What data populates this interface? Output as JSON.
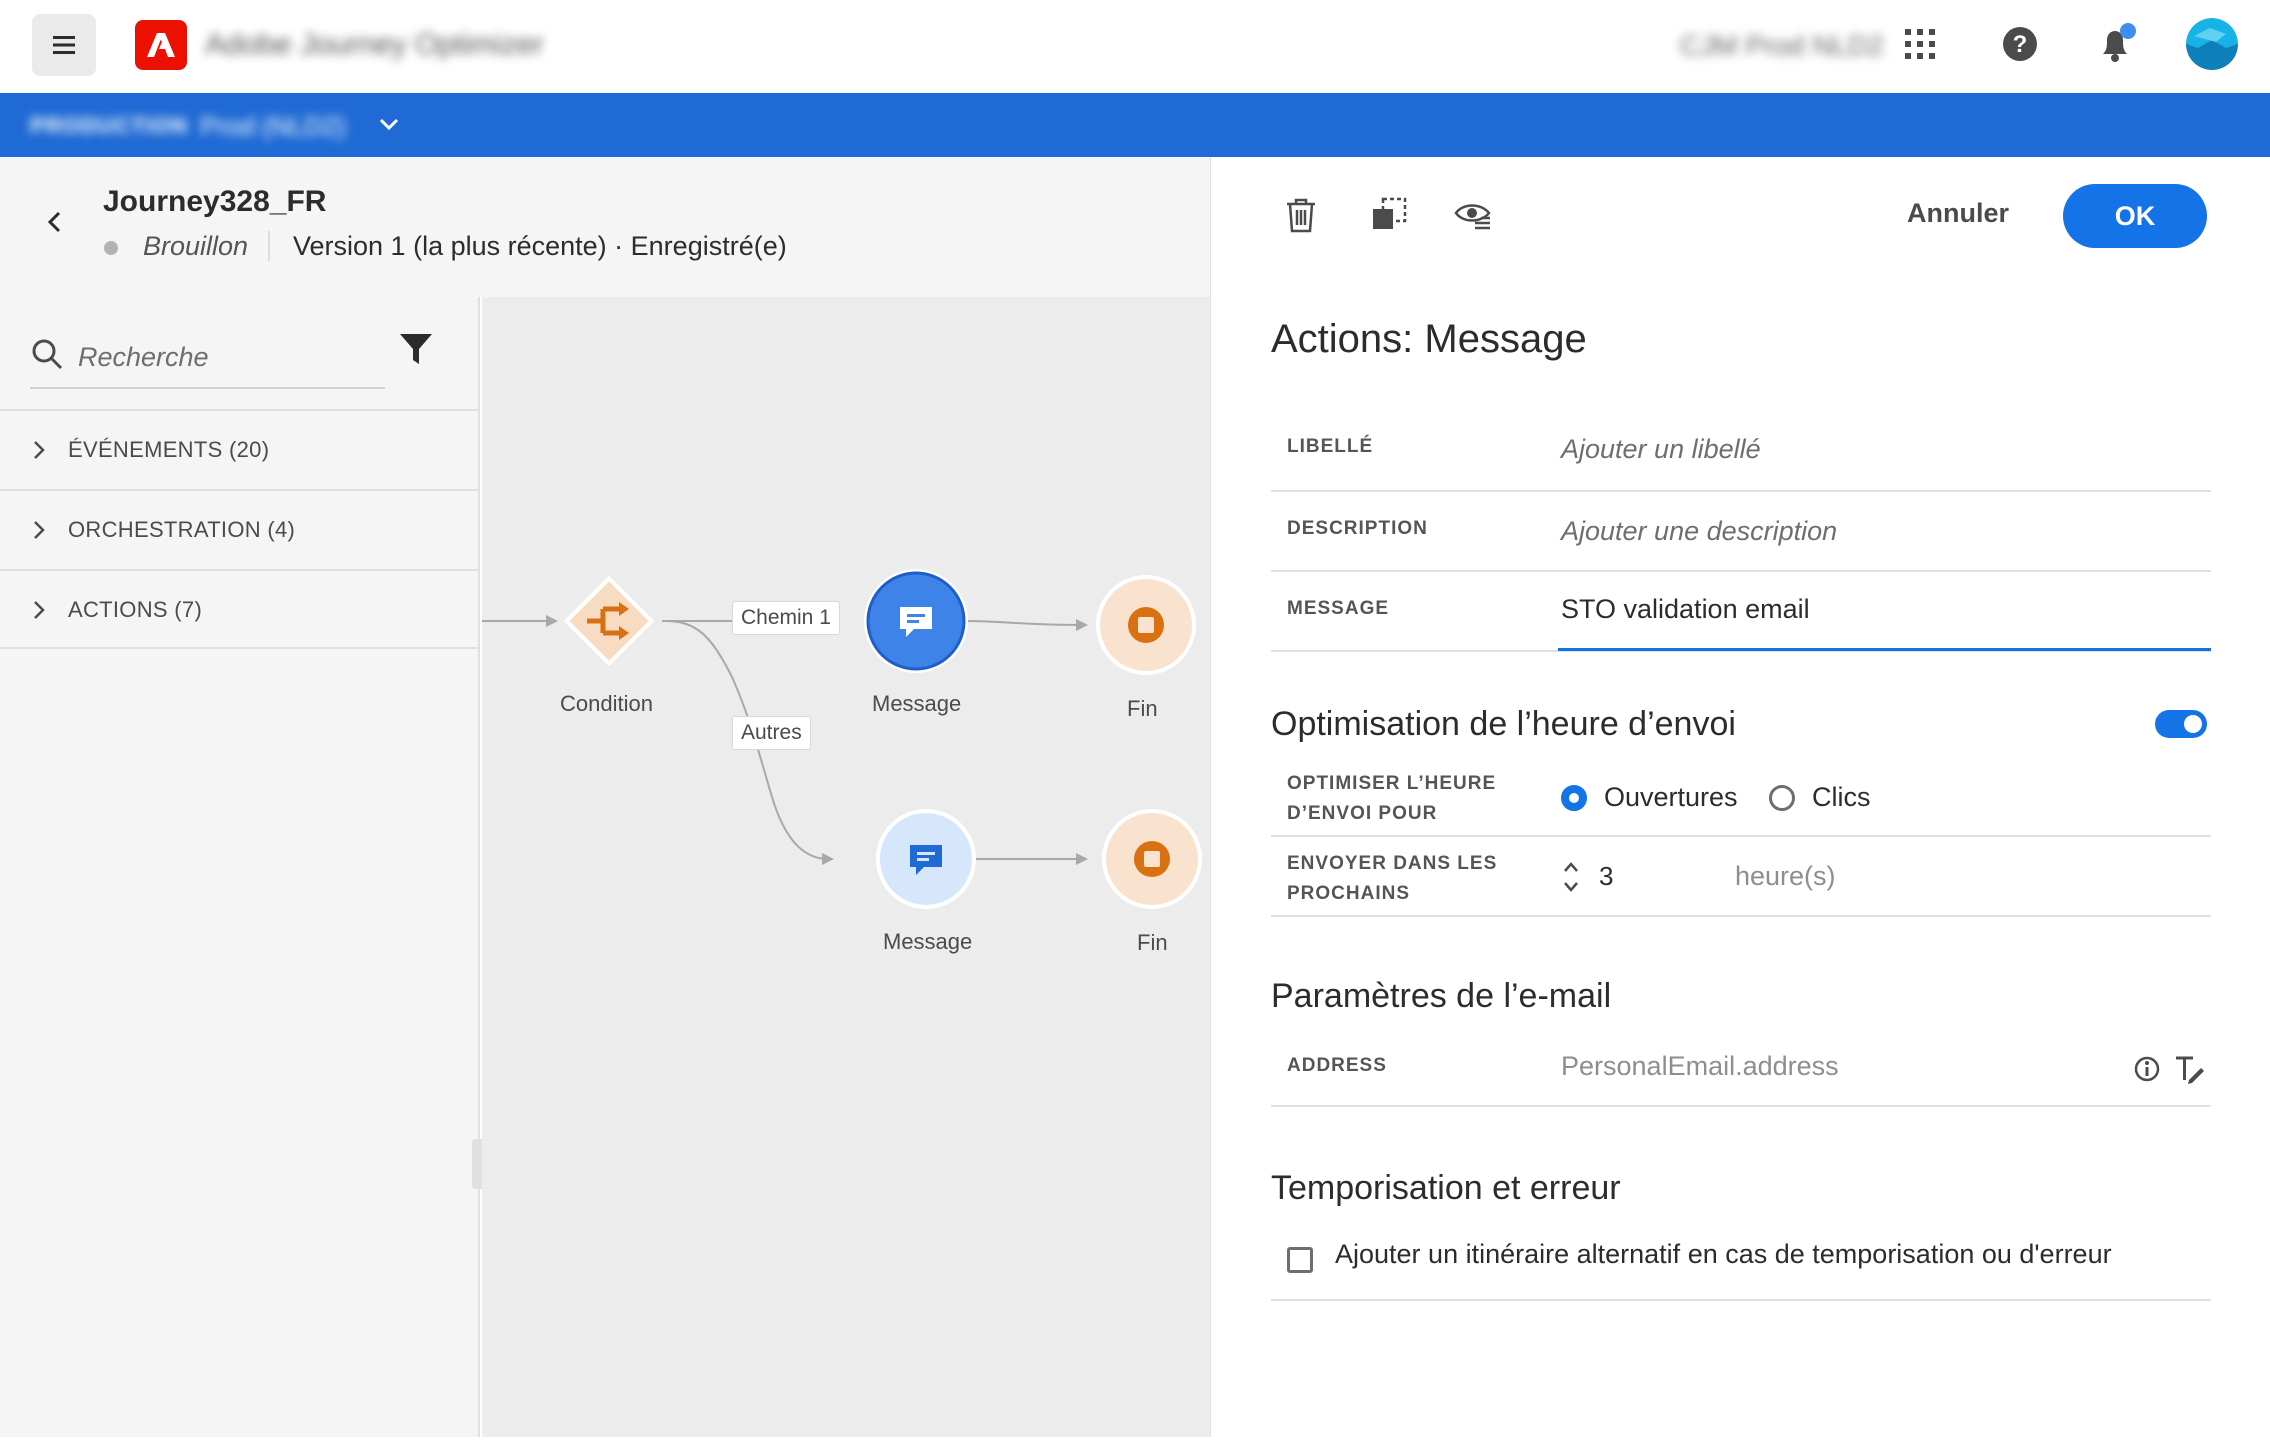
{
  "shell": {
    "app_name": "Adobe Journey Optimizer",
    "org_name": "CJM Prod NLD2"
  },
  "sandbox": {
    "type_label": "PRODUCTION",
    "name": "Prod (NLD2)"
  },
  "journey": {
    "title": "Journey328_FR",
    "status": "Brouillon",
    "version": "Version 1 (la plus récente) · Enregistré(e)"
  },
  "palette": {
    "search_placeholder": "Recherche",
    "sections": [
      {
        "label": "ÉVÉNEMENTS (20)"
      },
      {
        "label": "ORCHESTRATION (4)"
      },
      {
        "label": "ACTIONS (7)"
      }
    ]
  },
  "canvas": {
    "nodes": {
      "condition": "Condition",
      "message_1": "Message",
      "end_1": "Fin",
      "message_2": "Message",
      "end_2": "Fin"
    },
    "paths": {
      "path_1": "Chemin 1",
      "other": "Autres"
    }
  },
  "panel": {
    "cancel_label": "Annuler",
    "ok_label": "OK",
    "title": "Actions: Message",
    "fields": {
      "label": {
        "name": "LIBELLÉ",
        "placeholder": "Ajouter un libellé"
      },
      "description": {
        "name": "DESCRIPTION",
        "placeholder": "Ajouter une description"
      },
      "message": {
        "name": "MESSAGE",
        "value": "STO validation email"
      }
    },
    "send_time": {
      "title": "Optimisation de l’heure d’envoi",
      "enabled": true,
      "optimize_for_label_1": "OPTIMISER L’HEURE",
      "optimize_for_label_2": "D’ENVOI POUR",
      "option_opens": "Ouvertures",
      "option_clicks": "Clics",
      "selected": "Ouvertures",
      "within_label_1": "ENVOYER DANS LES",
      "within_label_2": "PROCHAINS",
      "within_value": "3",
      "within_unit": "heure(s)"
    },
    "email_params": {
      "title": "Paramètres de l’e-mail",
      "address_label": "ADDRESS",
      "address_value": "PersonalEmail.address"
    },
    "timeout": {
      "title": "Temporisation et erreur",
      "checkbox_label": "Ajouter un itinéraire alternatif en cas de temporisation ou d'erreur",
      "checked": false
    }
  },
  "colors": {
    "accent": "#1473e6",
    "sandbox_bar": "#1f6ad4",
    "adobe_red": "#eb1000",
    "condition_orange": "#d97011",
    "end_fill": "#f9e3cf",
    "message_active": "#3d83e8",
    "message_light": "#d6e7fb"
  }
}
